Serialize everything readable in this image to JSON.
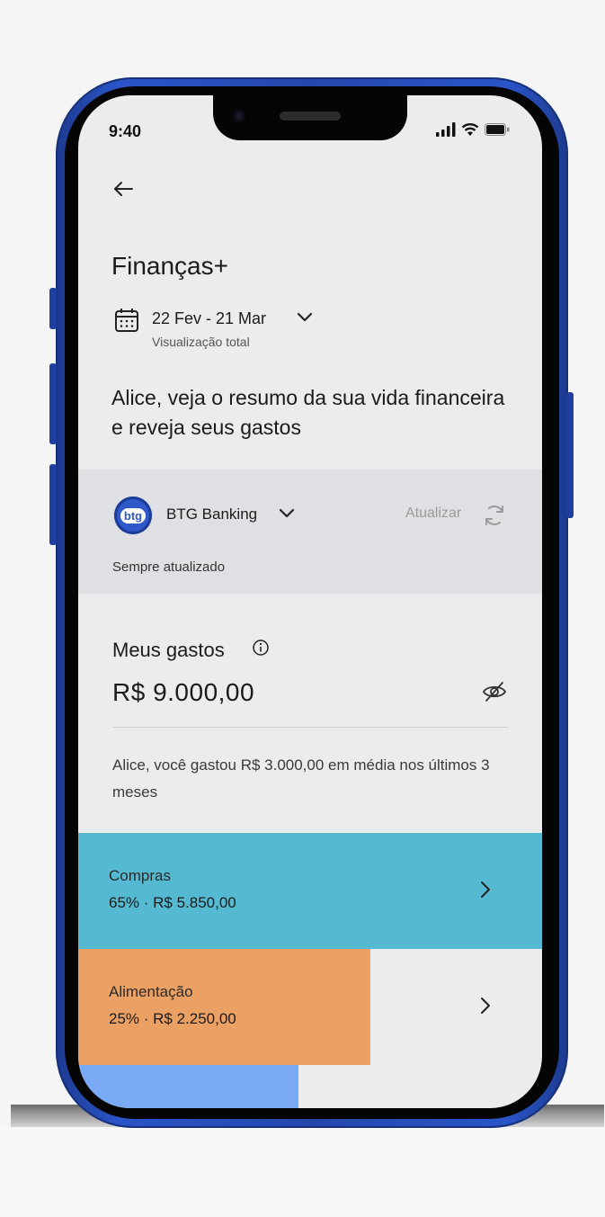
{
  "status_bar": {
    "time": "9:40"
  },
  "header": {
    "back_icon": "arrow-left-icon",
    "title": "Finanças+",
    "period": "22 Fev - 21 Mar",
    "period_subtitle": "Visualização total"
  },
  "intro_text": "Alice, veja o resumo da sua vida financeira e reveja seus gastos",
  "bank": {
    "logo_text": "btg",
    "name": "BTG Banking",
    "update_label": "Atualizar",
    "status": "Sempre atualizado",
    "logo_color": "#2f59c8"
  },
  "spending": {
    "label": "Meus gastos",
    "total": "R$ 9.000,00",
    "average_text": "Alice, você gastou R$ 3.000,00 em média nos últimos 3 meses"
  },
  "categories": [
    {
      "name": "Compras",
      "detail": "65% · R$ 5.850,00",
      "share": 1.0,
      "color": "#55bad1"
    },
    {
      "name": "Alimentação",
      "detail": "25% · R$ 2.250,00",
      "share": 0.63,
      "color": "#eba064"
    },
    {
      "name": "",
      "detail": "",
      "share": 0.475,
      "color": "#7aa9f5"
    }
  ],
  "colors": {
    "screen_bg": "#ebecee",
    "frame_blue": "#2447ad"
  }
}
